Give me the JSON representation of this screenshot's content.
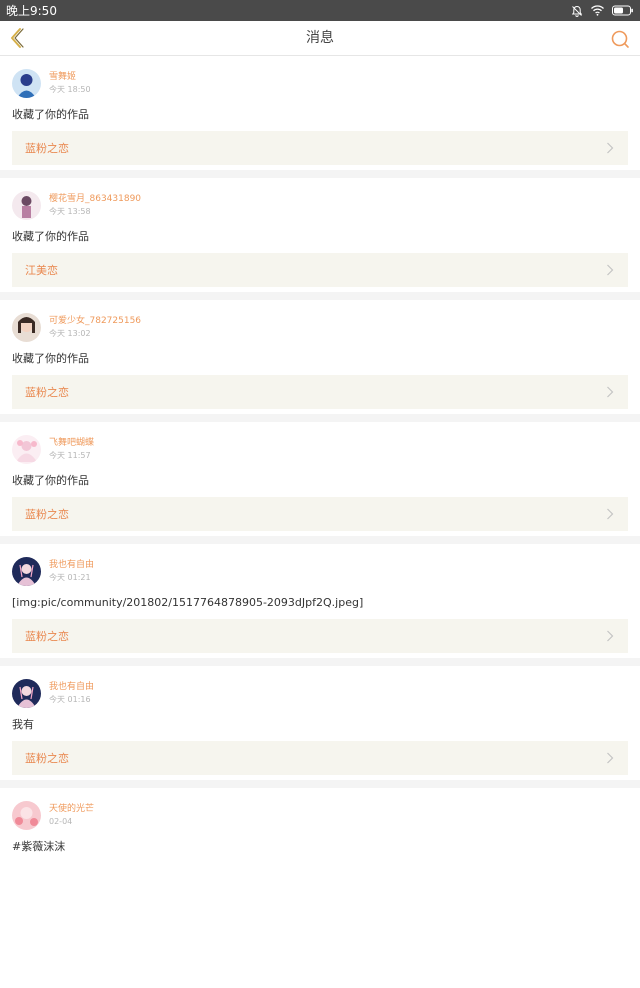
{
  "status_bar": {
    "time": "晚上9:50",
    "icons": [
      "bell-off-icon",
      "wifi-icon",
      "battery-icon"
    ]
  },
  "nav": {
    "title": "消息",
    "back_icon": "chevron-left-icon",
    "search_icon": "search-icon"
  },
  "colors": {
    "accent": "#ef9a5c",
    "work_link_bg": "#f6f5ee",
    "status_bar_bg": "#4a4a4a"
  },
  "messages": [
    {
      "user": "雪舞姬",
      "time": "今天 18:50",
      "content": "收藏了你的作品",
      "work": "蓝粉之恋"
    },
    {
      "user": "樱花雪月_863431890",
      "time": "今天 13:58",
      "content": "收藏了你的作品",
      "work": "江美恋"
    },
    {
      "user": "可爱少女_782725156",
      "time": "今天 13:02",
      "content": "收藏了你的作品",
      "work": "蓝粉之恋"
    },
    {
      "user": "飞舞吧蝴蝶",
      "time": "今天 11:57",
      "content": "收藏了你的作品",
      "work": "蓝粉之恋"
    },
    {
      "user": "我也有自由",
      "time": "今天 01:21",
      "content": "[img:pic/community/201802/1517764878905-2093dJpf2Q.jpeg]",
      "work": "蓝粉之恋"
    },
    {
      "user": "我也有自由",
      "time": "今天 01:16",
      "content": "我有",
      "work": "蓝粉之恋"
    },
    {
      "user": "天使的光芒",
      "time": "02-04",
      "content": "#紫薇沫沫"
    }
  ]
}
